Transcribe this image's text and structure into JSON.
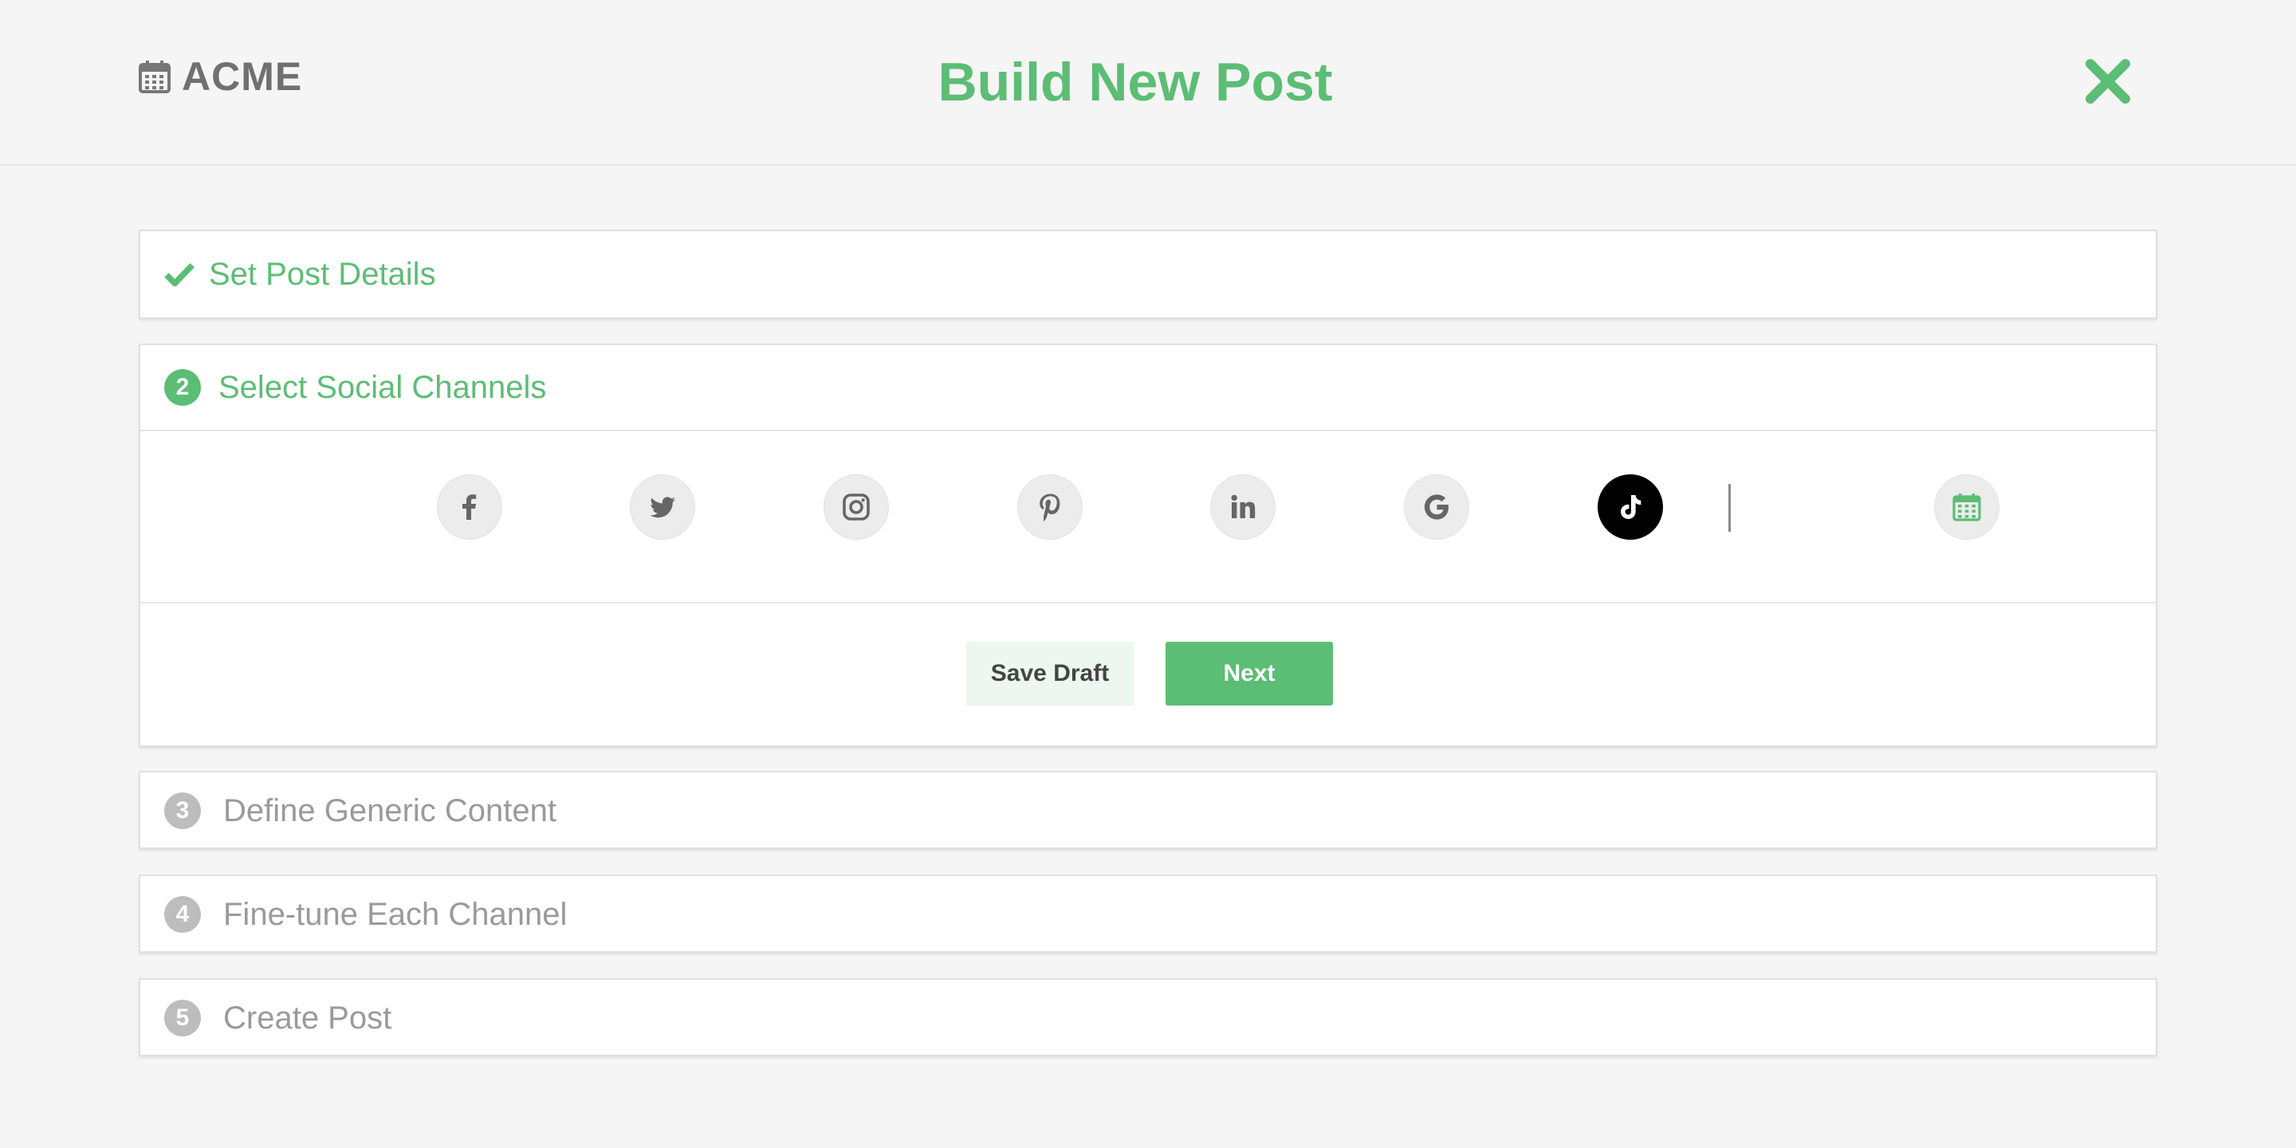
{
  "header": {
    "brand": "ACME",
    "title": "Build New Post"
  },
  "steps": [
    {
      "number": "",
      "title": "Set Post Details",
      "state": "completed"
    },
    {
      "number": "2",
      "title": "Select Social Channels",
      "state": "active"
    },
    {
      "number": "3",
      "title": "Define Generic Content",
      "state": "pending"
    },
    {
      "number": "4",
      "title": "Fine-tune Each Channel",
      "state": "pending"
    },
    {
      "number": "5",
      "title": "Create Post",
      "state": "pending"
    }
  ],
  "channels": [
    {
      "icon": "facebook-icon",
      "selected": false
    },
    {
      "icon": "twitter-icon",
      "selected": false
    },
    {
      "icon": "instagram-icon",
      "selected": false
    },
    {
      "icon": "pinterest-icon",
      "selected": false
    },
    {
      "icon": "linkedin-icon",
      "selected": false
    },
    {
      "icon": "google-icon",
      "selected": false
    },
    {
      "icon": "tiktok-icon",
      "selected": true
    },
    {
      "icon": "calendar-icon",
      "selected": false
    }
  ],
  "actions": {
    "save_draft": "Save Draft",
    "next": "Next"
  },
  "colors": {
    "accent": "#5cbd75",
    "muted_text": "#9a9a9a",
    "pending_badge": "#bdbdbd",
    "background": "#f5f5f5"
  }
}
